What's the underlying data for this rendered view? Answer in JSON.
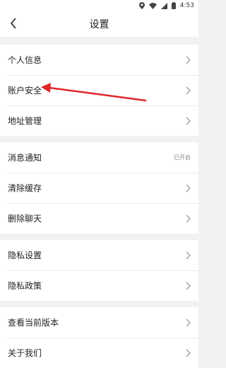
{
  "status_bar": {
    "time": "4:53",
    "icons": [
      "location-icon",
      "wifi-icon",
      "signal-icon",
      "battery-icon"
    ]
  },
  "header": {
    "title": "设置"
  },
  "groups": [
    {
      "items": [
        {
          "label": "个人信息"
        },
        {
          "label": "账户安全"
        },
        {
          "label": "地址管理"
        }
      ]
    },
    {
      "items": [
        {
          "label": "消息通知",
          "value": "已开启"
        },
        {
          "label": "清除缓存"
        },
        {
          "label": "删除聊天"
        }
      ]
    },
    {
      "items": [
        {
          "label": "隐私设置"
        },
        {
          "label": "隐私政策"
        }
      ]
    },
    {
      "items": [
        {
          "label": "查看当前版本"
        },
        {
          "label": "关于我们"
        }
      ]
    }
  ],
  "colors": {
    "annotation_arrow": "#e0262a"
  }
}
